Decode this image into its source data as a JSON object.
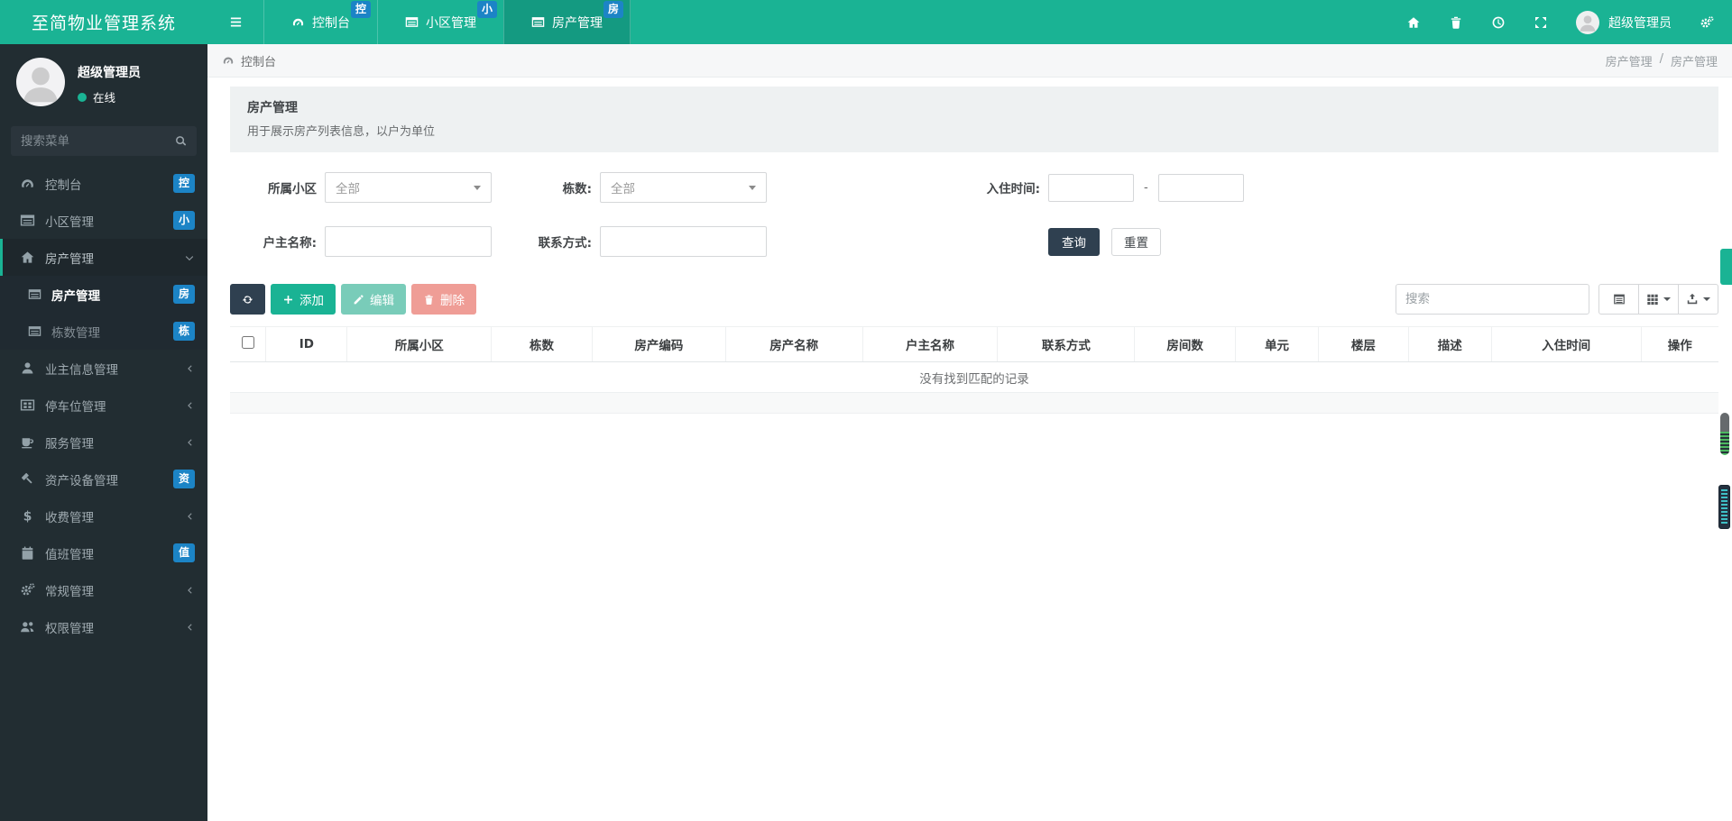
{
  "app": {
    "brand": "至简物业管理系统"
  },
  "topbar": {
    "tabs": [
      {
        "label": "控制台",
        "badge": "控"
      },
      {
        "label": "小区管理",
        "badge": "小"
      },
      {
        "label": "房产管理",
        "badge": "房"
      }
    ],
    "user_name": "超级管理员"
  },
  "sidebar": {
    "user_name": "超级管理员",
    "status": "在线",
    "search_placeholder": "搜索菜单",
    "items": [
      {
        "label": "控制台",
        "badge": "控"
      },
      {
        "label": "小区管理",
        "badge": "小"
      },
      {
        "label": "房产管理"
      },
      {
        "label": "房产管理",
        "badge": "房"
      },
      {
        "label": "栋数管理",
        "badge": "栋"
      },
      {
        "label": "业主信息管理"
      },
      {
        "label": "停车位管理"
      },
      {
        "label": "服务管理"
      },
      {
        "label": "资产设备管理",
        "badge": "资"
      },
      {
        "label": "收费管理"
      },
      {
        "label": "值班管理",
        "badge": "值"
      },
      {
        "label": "常规管理"
      },
      {
        "label": "权限管理"
      }
    ]
  },
  "breadcrumb": {
    "left": "控制台",
    "path1": "房产管理",
    "separator": "/",
    "path2": "房产管理"
  },
  "panel": {
    "title": "房产管理",
    "subtitle": "用于展示房产列表信息，以户为单位"
  },
  "filters": {
    "community_label": "所属小区",
    "community_value": "全部",
    "building_label": "栋数:",
    "building_value": "全部",
    "checkin_label": "入住时间:",
    "range_separator": "-",
    "owner_label": "户主名称:",
    "contact_label": "联系方式:",
    "query_button": "查询",
    "reset_button": "重置"
  },
  "toolbar": {
    "add_label": "添加",
    "edit_label": "编辑",
    "delete_label": "删除",
    "search_placeholder": "搜索"
  },
  "table": {
    "columns": [
      "ID",
      "所属小区",
      "栋数",
      "房产编码",
      "房产名称",
      "户主名称",
      "联系方式",
      "房间数",
      "单元",
      "楼层",
      "描述",
      "入住时间",
      "操作"
    ],
    "empty_text": "没有找到匹配的记录"
  },
  "colors": {
    "accent": "#1ab394",
    "active_tab": "#149a81",
    "badge_blue": "#1c84c6",
    "dark_btn": "#2f4050",
    "danger": "#ed5565",
    "sidebar_bg": "#222d32"
  }
}
